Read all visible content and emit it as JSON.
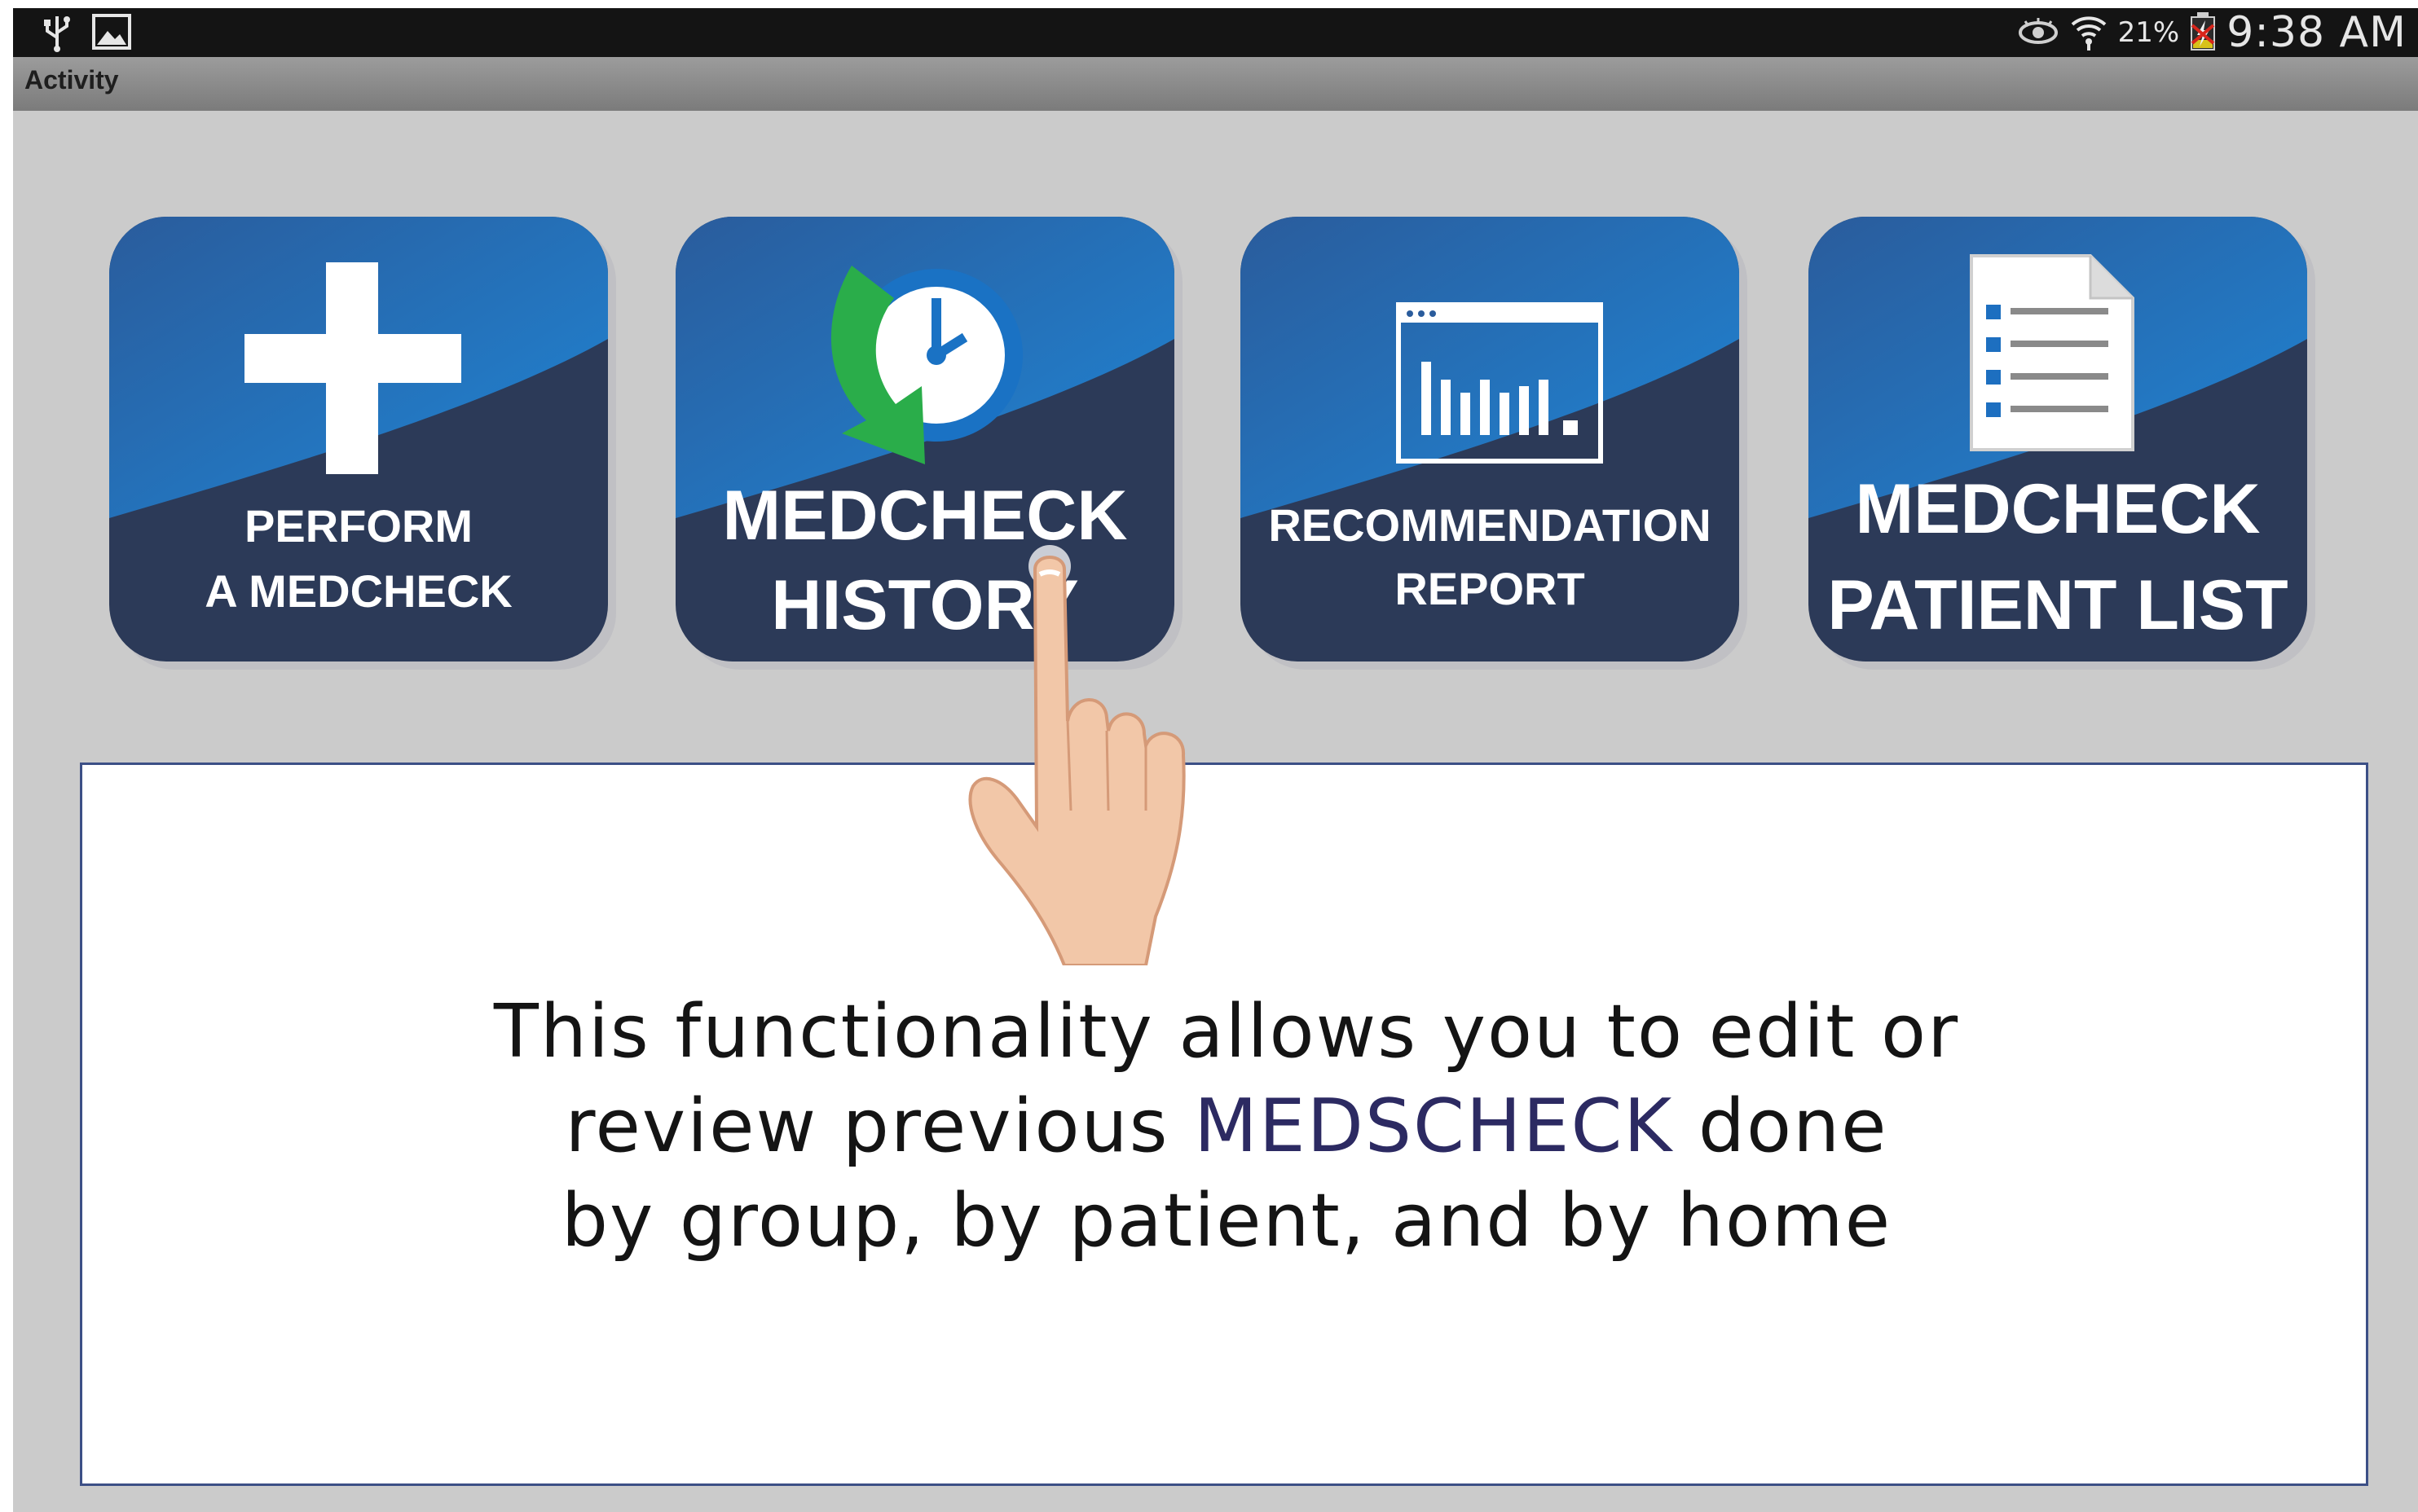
{
  "status_bar": {
    "battery_percent": "21%",
    "time": "9:38 AM",
    "icons": [
      "usb-icon",
      "image-icon",
      "eye-icon",
      "wifi-icon",
      "battery-icon"
    ]
  },
  "action_bar": {
    "title": "Activity"
  },
  "tiles": [
    {
      "line1": "PERFORM",
      "line2": "A MEDCHECK",
      "icon": "plus-icon"
    },
    {
      "line1": "MEDCHECK",
      "line2": "HISTORY",
      "icon": "history-clock-icon"
    },
    {
      "line1": "RECOMMENDATION",
      "line2": "REPORT",
      "icon": "report-chart-icon"
    },
    {
      "line1": "MEDCHECK",
      "line2": "PATIENT LIST",
      "icon": "document-list-icon"
    }
  ],
  "info": {
    "line1": "This functionality allows you to edit or",
    "line2_pre": "review previous ",
    "line2_highlight": "MEDSCHECK",
    "line2_post": " done",
    "line3": "by group, by patient, and by home"
  },
  "colors": {
    "tile_dark": "#2c3a58",
    "tile_blue": "#1d78c8",
    "highlight_text": "#2c2a62",
    "screen_bg": "#cbcbcb"
  }
}
